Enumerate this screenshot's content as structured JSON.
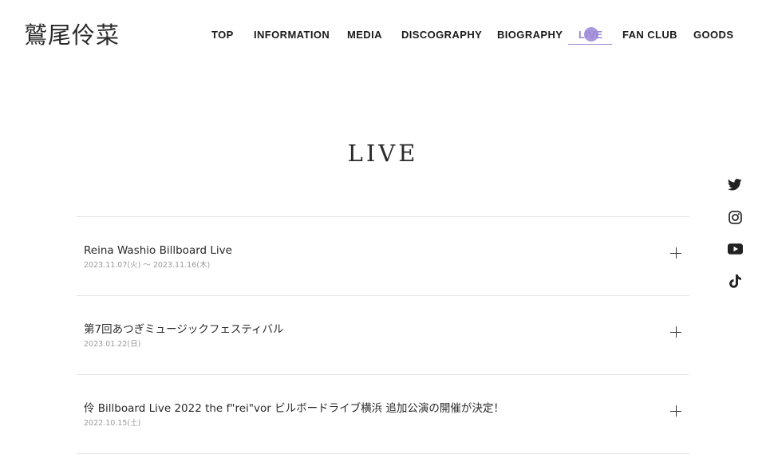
{
  "header": {
    "logo_text": "鷲尾伶菜",
    "nav": [
      {
        "label": "TOP",
        "active": false
      },
      {
        "label": "INFORMATION",
        "active": false
      },
      {
        "label": "MEDIA",
        "active": false
      },
      {
        "label": "DISCOGRAPHY",
        "active": false
      },
      {
        "label": "BIOGRAPHY",
        "active": false
      },
      {
        "label": "LIVE",
        "active": true
      },
      {
        "label": "FAN CLUB",
        "active": false
      },
      {
        "label": "GOODS",
        "active": false
      }
    ]
  },
  "main": {
    "title": "LIVE",
    "items": [
      {
        "title": "Reina Washio Billboard Live",
        "date": "2023.11.07(火) 〜 2023.11.16(木)"
      },
      {
        "title": "第7回あつぎミュージックフェスティバル",
        "date": "2023.01.22(日)"
      },
      {
        "title": "伶 Billboard Live 2022 the f\"rei\"vor ビルボードライブ横浜 追加公演の開催が決定！",
        "date": "2022.10.15(土)"
      }
    ]
  },
  "social": [
    "twitter-icon",
    "instagram-icon",
    "youtube-icon",
    "tiktok-icon"
  ],
  "colors": {
    "accent": "#9b86d6",
    "text": "#222222",
    "divider": "#e6e6e6",
    "date": "#9a9a9a"
  }
}
